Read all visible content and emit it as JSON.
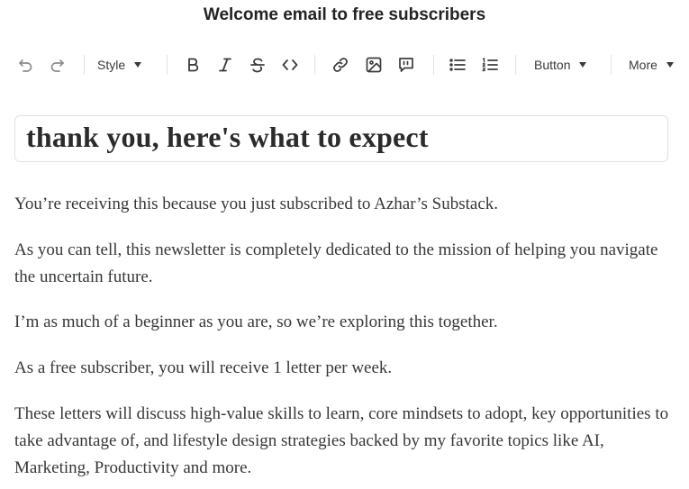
{
  "email": {
    "title": "Welcome email to free subscribers",
    "heading": "thank you, here's what to expect",
    "paragraphs": [
      "You’re receiving this because you just subscribed to Azhar’s Substack.",
      "As you can tell, this newsletter is completely dedicated to the mission of helping you navigate the uncertain future.",
      "I’m as much of a beginner as you are, so we’re exploring this together.",
      "As a free subscriber, you will receive 1 letter per week.",
      "These letters will discuss high-value skills to learn, core mindsets to adopt, key opportunities to take advantage of, and lifestyle design strategies backed by my favorite topics like AI, Marketing, Productivity and more."
    ]
  },
  "toolbar": {
    "style_label": "Style",
    "button_label": "Button",
    "more_label": "More",
    "icons": [
      "undo-icon",
      "redo-icon",
      "bold-icon",
      "italic-icon",
      "strikethrough-icon",
      "code-icon",
      "link-icon",
      "image-icon",
      "quote-icon",
      "bullet-list-icon",
      "numbered-list-icon"
    ]
  }
}
